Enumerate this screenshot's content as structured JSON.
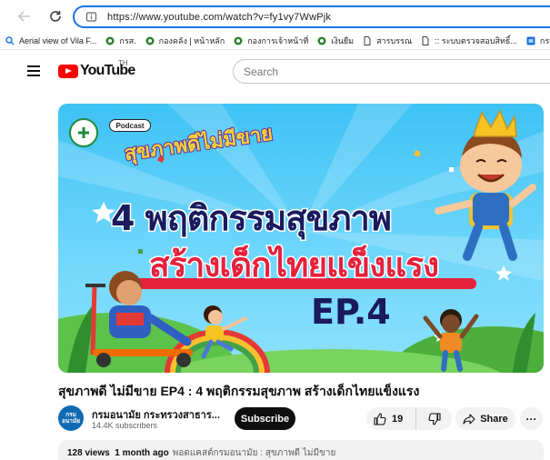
{
  "browser": {
    "url": "https://www.youtube.com/watch?v=fy1vy7WwPjk",
    "bookmarks": [
      {
        "label": "Aerial view of Vila F...",
        "icon": "search-icon"
      },
      {
        "label": "กรส.",
        "icon": "shield-icon"
      },
      {
        "label": "กองคลัง | หน้าหลัก",
        "icon": "shield-icon"
      },
      {
        "label": "กองการเจ้าหน้าที่",
        "icon": "shield-icon"
      },
      {
        "label": "เงินยืม",
        "icon": "shield-icon"
      },
      {
        "label": "สารบรรณ",
        "icon": "page-icon"
      },
      {
        "label": ":: ระบบตรวจสอบสิทธิ์...",
        "icon": "page-icon"
      },
      {
        "label": "กรม",
        "icon": "app-icon"
      }
    ]
  },
  "youtube": {
    "logo_text": "YouTube",
    "region": "TH",
    "search_placeholder": "Search"
  },
  "thumbnail": {
    "podcast_tag": "Podcast",
    "show_name": "สุขภาพดีไม่มีขาย",
    "headline_1": "4 พฤติกรรมสุขภาพ",
    "headline_2": "สร้างเด็กไทยแข็งแรง",
    "episode": "EP.4"
  },
  "video": {
    "title": "สุขภาพดี ไม่มีขาย EP4 : 4 พฤติกรรมสุขภาพ สร้างเด็กไทยแข็งแรง",
    "channel_name": "กรมอนามัย กระทรวงสาธาร...",
    "avatar_text": "กรม อนามัย",
    "subscribers": "14.4K subscribers",
    "subscribe_label": "Subscribe",
    "likes": "19",
    "share_label": "Share",
    "more_label": "···",
    "views": "128 views",
    "age": "1 month ago",
    "tags": "พอดแคสต์กรมอนามัย : สุขภาพดี ไม่มีขาย"
  },
  "colors": {
    "accent_blue": "#1a73e8",
    "youtube_red": "#ff0000",
    "thumbnail_sky": "#3ec2f5",
    "headline_navy": "#1a1a5e",
    "headline_red": "#e6213c"
  }
}
